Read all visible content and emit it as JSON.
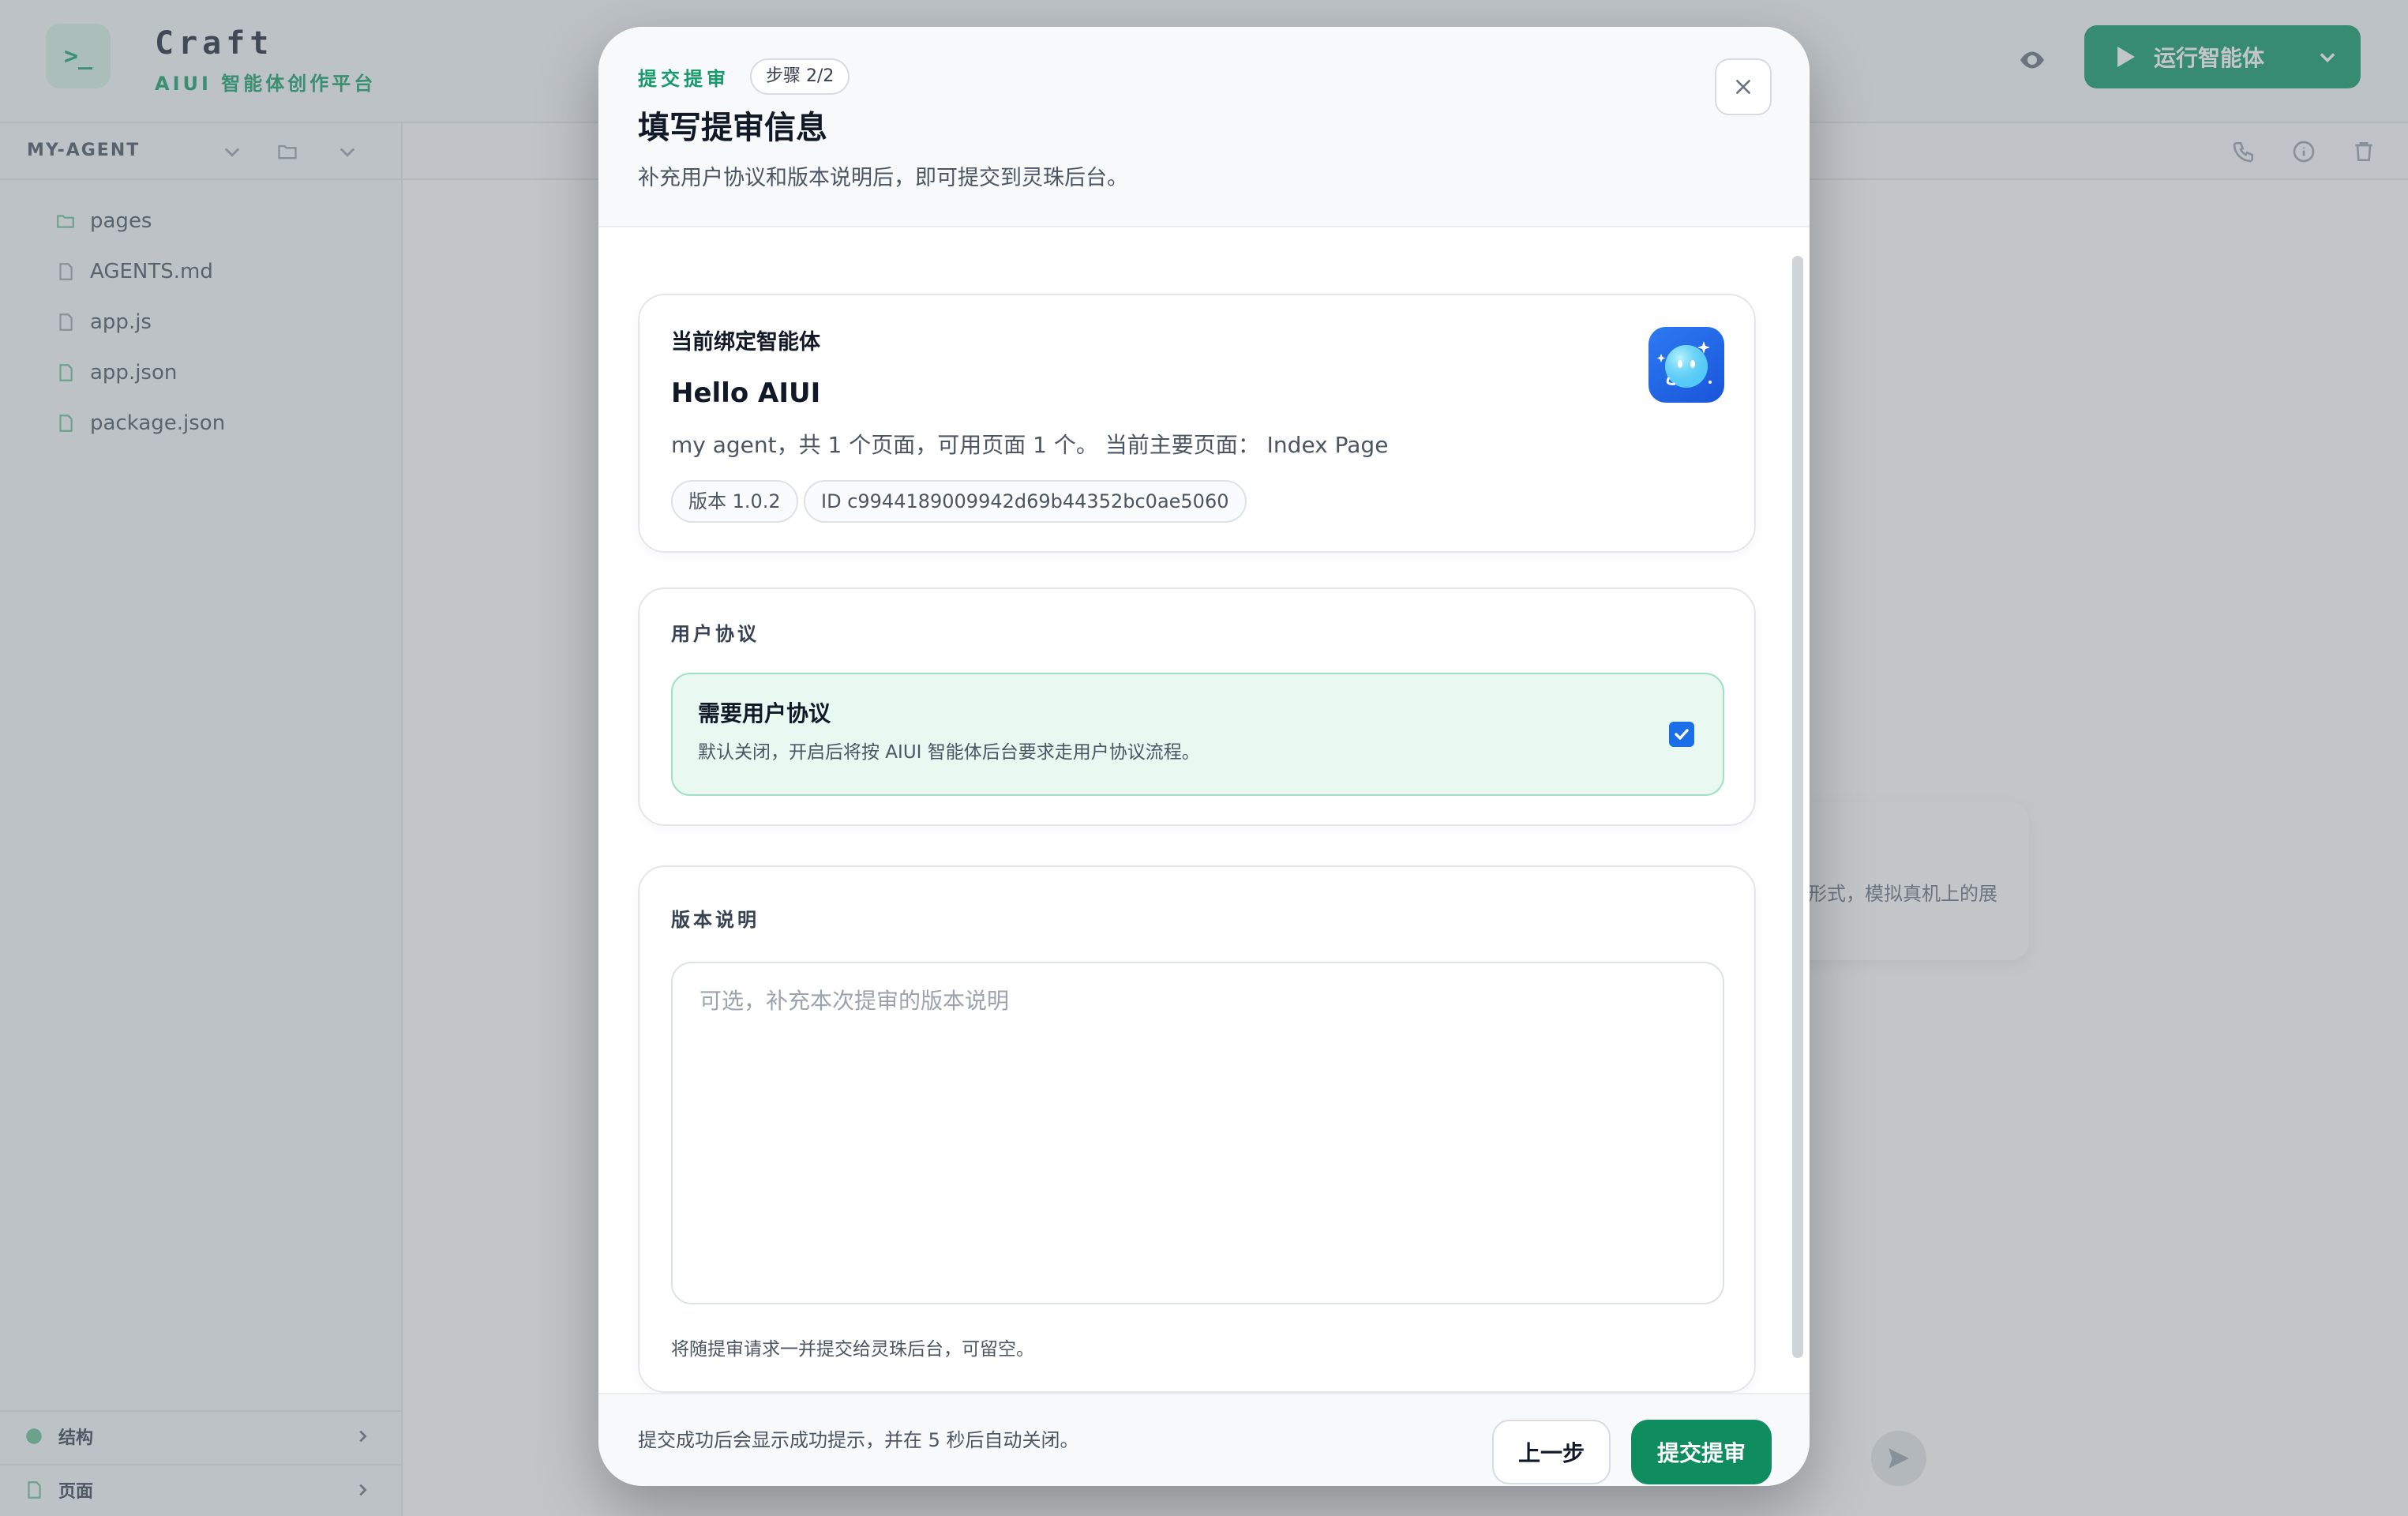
{
  "background": {
    "brand": {
      "name": "Craft",
      "subtitle": "AIUI 智能体创作平台",
      "logo_glyph": ">_"
    },
    "run_button_label": "运行智能体",
    "sidebar": {
      "project_name": "MY-AGENT",
      "files": [
        {
          "name": "pages",
          "icon": "folder-icon"
        },
        {
          "name": "AGENTS.md",
          "icon": "file-icon"
        },
        {
          "name": "app.js",
          "icon": "file-icon"
        },
        {
          "name": "app.json",
          "icon": "json-file-icon"
        },
        {
          "name": "package.json",
          "icon": "json-file-icon"
        }
      ],
      "bottom_items": [
        {
          "label": "结构"
        },
        {
          "label": "页面"
        }
      ]
    },
    "card_snippet": "形式，模拟真机上的展"
  },
  "modal": {
    "eyebrow": "提交提审",
    "step": "步骤 2/2",
    "title": "填写提审信息",
    "description": "补充用户协议和版本说明后，即可提交到灵珠后台。",
    "agent": {
      "section_label": "当前绑定智能体",
      "name": "Hello AIUI",
      "summary": "my agent，共 1 个页面，可用页面 1 个。 当前主要页面： Index Page",
      "version_tag": "版本 1.0.2",
      "id_tag": "ID c9944189009942d69b44352bc0ae5060"
    },
    "agreement": {
      "section_label": "用户协议",
      "title": "需要用户协议",
      "description": "默认关闭，开启后将按 AIUI 智能体后台要求走用户协议流程。",
      "checked": true
    },
    "notes": {
      "section_label": "版本说明",
      "placeholder": "可选，补充本次提审的版本说明",
      "value": "",
      "help": "将随提审请求一并提交给灵珠后台，可留空。"
    },
    "footer": {
      "hint": "提交成功后会显示成功提示，并在 5 秒后自动关闭。",
      "prev_label": "上一步",
      "submit_label": "提交提审"
    }
  },
  "colors": {
    "accent": "#0f8d5f",
    "accent_light": "#e9f9f1",
    "checkbox": "#1a6fe8"
  }
}
